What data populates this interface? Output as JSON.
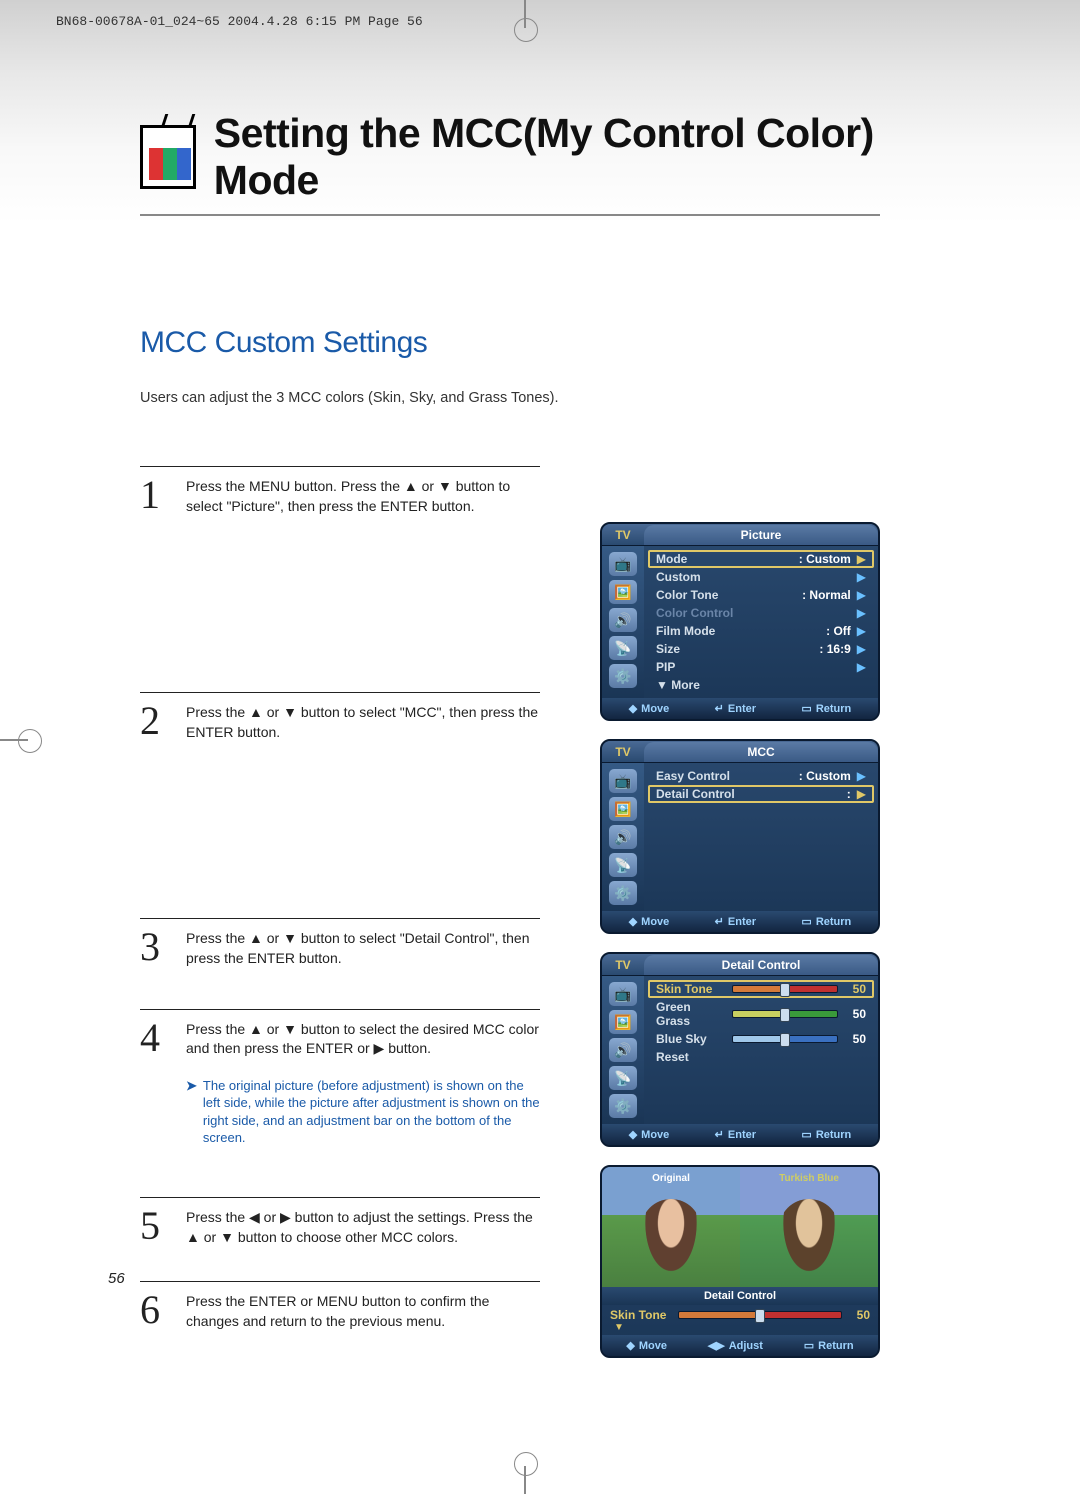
{
  "cropHeader": "BN68-00678A-01_024~65  2004.4.28  6:15 PM  Page 56",
  "mainTitle": "Setting the MCC(My Control Color) Mode",
  "subtitle": "MCC Custom Settings",
  "intro": "Users can adjust the 3 MCC colors (Skin, Sky, and Grass Tones).",
  "pageNumber": "56",
  "steps": [
    {
      "num": "1",
      "text": "Press the MENU button. Press the ▲ or ▼ button to select \"Picture\", then press the ENTER button."
    },
    {
      "num": "2",
      "text": "Press the ▲ or ▼ button to select \"MCC\", then press the ENTER button."
    },
    {
      "num": "3",
      "text": "Press the ▲ or ▼ button to select \"Detail Control\", then press the ENTER button."
    },
    {
      "num": "4",
      "text": "Press the ▲ or ▼ button to select the desired MCC color and then press the ENTER or ▶ button.",
      "note": "The original picture (before adjustment) is shown on the left side, while the picture after adjustment is shown on the right side, and an adjustment bar on the bottom of the screen."
    },
    {
      "num": "5",
      "text": "Press the ◀ or ▶ button to adjust the settings. Press the ▲ or ▼ button to choose other MCC colors."
    },
    {
      "num": "6",
      "text": "Press the ENTER or MENU button to confirm the changes and return to the previous menu."
    }
  ],
  "osd": {
    "footer": {
      "move": "Move",
      "enter": "Enter",
      "ret": "Return",
      "adjust": "Adjust"
    },
    "tvTab": "TV",
    "picture": {
      "title": "Picture",
      "rows": [
        {
          "lbl": "Mode",
          "val": "Custom",
          "sel": true
        },
        {
          "lbl": "Custom",
          "val": ""
        },
        {
          "lbl": "Color Tone",
          "val": "Normal"
        },
        {
          "lbl": "Color Control",
          "val": "",
          "dim": true
        },
        {
          "lbl": "Film Mode",
          "val": "Off"
        },
        {
          "lbl": "Size",
          "val": "16:9"
        },
        {
          "lbl": "PIP",
          "val": ""
        },
        {
          "lbl": "▼ More",
          "val": "",
          "noarr": true
        }
      ]
    },
    "mcc": {
      "title": "MCC",
      "rows": [
        {
          "lbl": "Easy Control",
          "val": "Custom"
        },
        {
          "lbl": "Detail Control",
          "val": "",
          "sel": true
        }
      ]
    },
    "detail": {
      "title": "Detail Control",
      "sliders": [
        {
          "lbl": "Skin Tone",
          "val": "50",
          "left": "#d47a3a",
          "right": "#c03030",
          "sel": true
        },
        {
          "lbl": "Green Grass",
          "val": "50",
          "left": "#c8d060",
          "right": "#3a9a3a"
        },
        {
          "lbl": "Blue Sky",
          "val": "50",
          "left": "#a0c8ea",
          "right": "#3a70c0"
        }
      ],
      "reset": "Reset"
    },
    "preview": {
      "leftLabel": "Original",
      "rightLabel": "Turkish Blue",
      "midTitle": "Detail Control",
      "slider": {
        "lbl": "Skin Tone",
        "val": "50",
        "left": "#d47a3a",
        "right": "#c03030"
      }
    }
  }
}
